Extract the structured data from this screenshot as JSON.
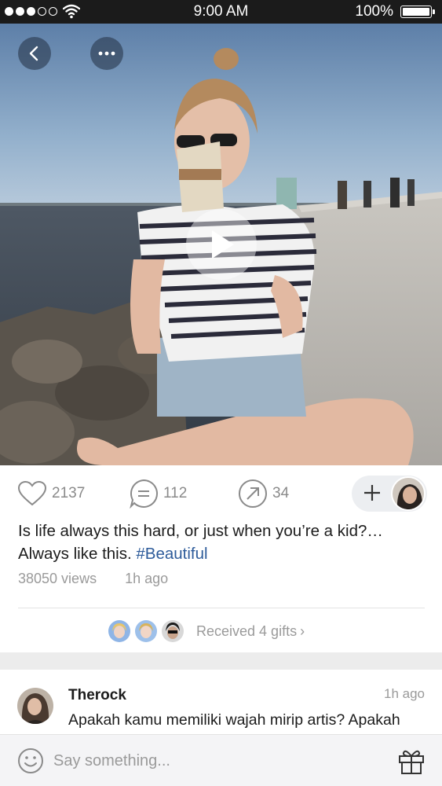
{
  "status_bar": {
    "time": "9:00 AM",
    "battery": "100%",
    "signal_bars": 3,
    "signal_total": 5
  },
  "post": {
    "likes": "2137",
    "comments": "112",
    "shares": "34",
    "caption_line1": "Is life always this hard, or just when you’re a kid?…",
    "caption_line2": "Always like this.",
    "hashtag": "#Beautiful",
    "views": "38050 views",
    "time_ago": "1h ago",
    "gifts_label": "Received 4 gifts"
  },
  "comment": {
    "author": "Therock",
    "time": "1h ago",
    "text": "Apakah kamu memiliki wajah mirip artis? Apakah"
  },
  "input": {
    "placeholder": "Say something..."
  },
  "colors": {
    "hashtag": "#2d5b9a",
    "muted": "#9a9a9a",
    "status_bar": "#1b1b1b"
  },
  "icons": [
    "back-icon",
    "more-icon",
    "play-icon",
    "heart-icon",
    "comment-icon",
    "share-icon",
    "plus-icon",
    "chevron-right-icon",
    "smiley-icon",
    "gift-icon"
  ]
}
